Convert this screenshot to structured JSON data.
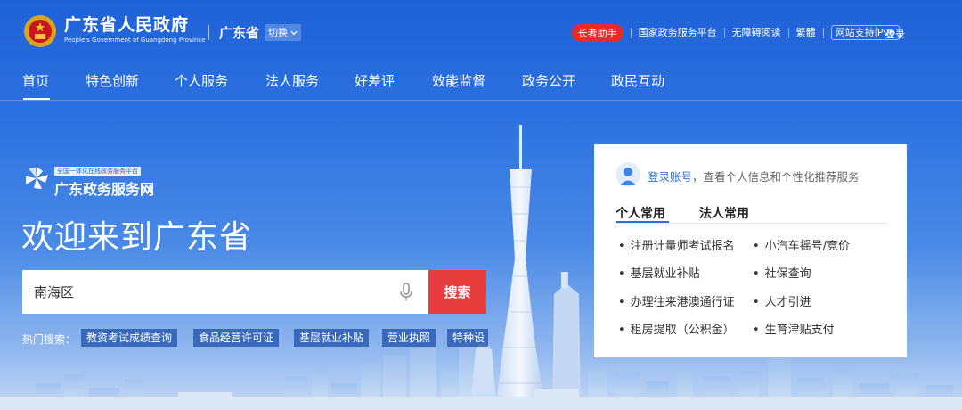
{
  "header": {
    "site_title": "广东省人民政府",
    "site_subtitle": "People's Government of Guangdong Province",
    "region": "广东省",
    "switch_label": "切换",
    "elder_mode": "长者助手",
    "links": [
      "国家政务服务平台",
      "无障碍阅读",
      "繁體"
    ],
    "ipv6": "网站支持IPv6",
    "login": "登录"
  },
  "nav": [
    "首页",
    "特色创新",
    "个人服务",
    "法人服务",
    "好差评",
    "效能监督",
    "政务公开",
    "政民互动"
  ],
  "hero": {
    "platform_tag": "全国一体化在线政务服务平台",
    "brand_name": "广东政务服务网",
    "welcome": "欢迎来到广东省",
    "search_value": "南海区",
    "search_button": "搜索",
    "hot_label": "热门搜索：",
    "hot_tags": [
      "教资考试成绩查询",
      "食品经营许可证",
      "基层就业补贴",
      "营业执照",
      "特种设"
    ]
  },
  "panel": {
    "login_link": "登录账号",
    "login_desc": "，查看个人信息和个性化推荐服务",
    "tabs": [
      "个人常用",
      "法人常用"
    ],
    "services": [
      "注册计量师考试报名",
      "小汽车摇号/竞价",
      "基层就业补贴",
      "社保查询",
      "办理往来港澳通行证",
      "人才引进",
      "租房提取（公积金）",
      "生育津贴支付"
    ]
  },
  "colors": {
    "brand_blue": "#1f61d8",
    "accent_red": "#e83d3d",
    "link_blue": "#2b6fd8"
  },
  "icons": {
    "emblem": "national-emblem-icon",
    "logo": "pinwheel-logo-icon",
    "mic": "microphone-icon",
    "user": "user-avatar-icon",
    "switch": "chevron-down-icon"
  }
}
